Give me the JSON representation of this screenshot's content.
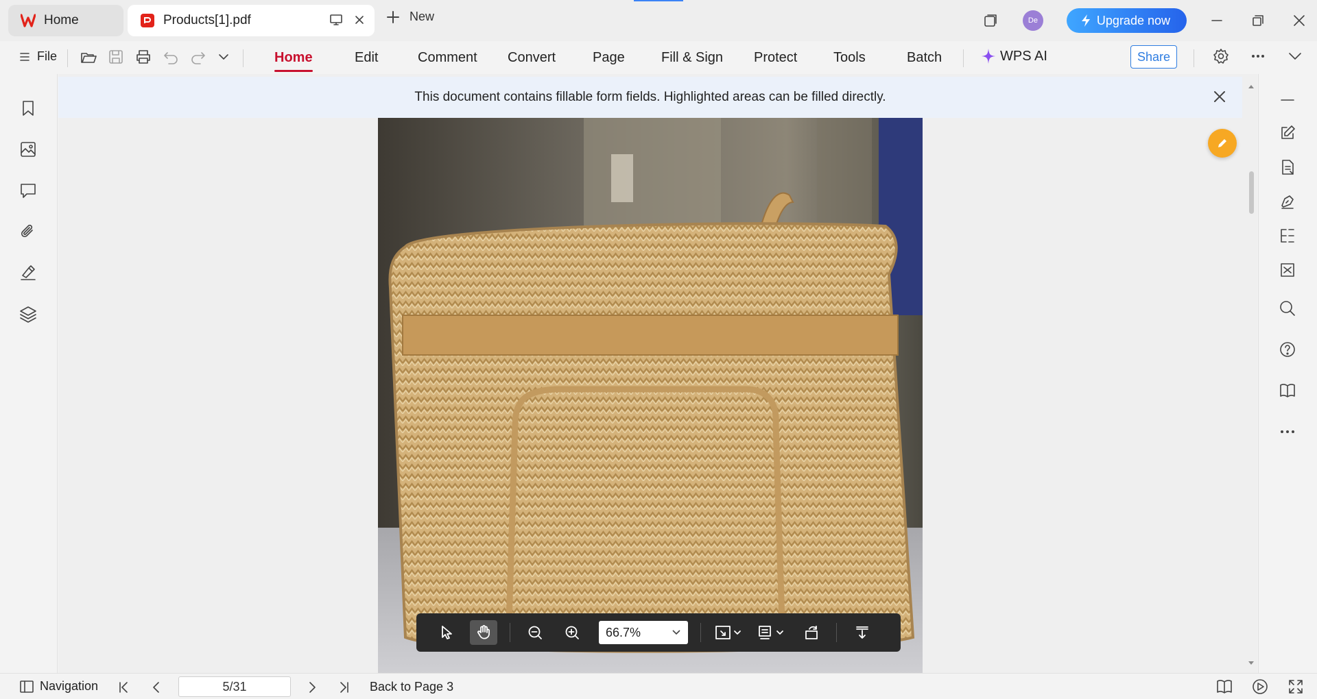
{
  "titlebar": {
    "home_tab_label": "Home",
    "doc_tab_label": "Products[1].pdf",
    "new_tab_label": "New",
    "avatar_initials": "De",
    "upgrade_label": "Upgrade now"
  },
  "toolbar": {
    "file_label": "File",
    "tabs": [
      "Home",
      "Edit",
      "Comment",
      "Convert",
      "Page",
      "Fill & Sign",
      "Protect",
      "Tools",
      "Batch"
    ],
    "ai_label": "WPS AI",
    "share_label": "Share",
    "active_tab": "Home",
    "accent_color": "#c8102e"
  },
  "banner": {
    "message": "This document contains fillable form fields. Highlighted areas can be filled directly."
  },
  "floating_toolbar": {
    "zoom_value": "66.7%",
    "active_tool": "hand"
  },
  "statusbar": {
    "navigation_label": "Navigation",
    "page_value": "5/31",
    "back_link": "Back to Page 3"
  },
  "icons": {
    "left_sidebar": [
      "bookmark-icon",
      "thumbnail-icon",
      "comment-icon",
      "attachment-icon",
      "signature-icon",
      "layers-icon"
    ],
    "right_sidebar": [
      "collapse-icon",
      "edit-icon",
      "document-icon",
      "pen-icon",
      "compare-icon",
      "scan-icon",
      "search-icon",
      "help-icon",
      "book-icon",
      "more-icon"
    ]
  },
  "colors": {
    "upgrade_gradient_start": "#3fa6ff",
    "upgrade_gradient_end": "#2563eb",
    "fab": "#f7a823",
    "banner_bg": "#ebf1fa"
  }
}
